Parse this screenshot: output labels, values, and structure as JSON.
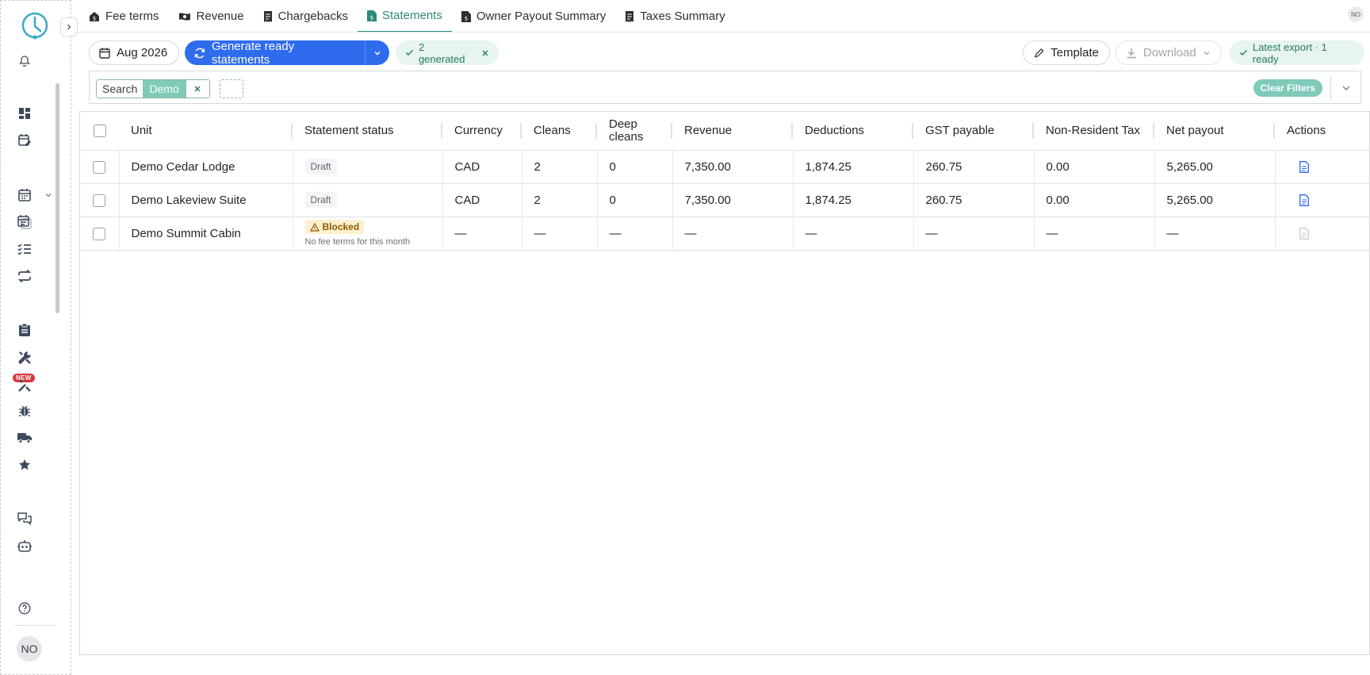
{
  "sidebar": {
    "badge_new": "NEW",
    "avatar_initials": "NO"
  },
  "tabs": [
    {
      "label": "Fee terms",
      "icon": "house-dollar-icon"
    },
    {
      "label": "Revenue",
      "icon": "money-icon"
    },
    {
      "label": "Chargebacks",
      "icon": "receipt-icon"
    },
    {
      "label": "Statements",
      "icon": "file-dollar-icon",
      "active": true
    },
    {
      "label": "Owner Payout Summary",
      "icon": "file-dollar-icon"
    },
    {
      "label": "Taxes Summary",
      "icon": "receipt-icon"
    }
  ],
  "header": {
    "user_initials": "NO"
  },
  "toolbar": {
    "date": "Aug 2026",
    "generate_label": "Generate ready statements",
    "generated_badge": "2 generated",
    "template_label": "Template",
    "download_label": "Download",
    "export_badge": "Latest export · 1 ready"
  },
  "filters": {
    "search_label": "Search",
    "search_value": "Demo",
    "clear_label": "Clear Filters"
  },
  "table": {
    "columns": [
      "Unit",
      "Statement status",
      "Currency",
      "Cleans",
      "Deep\ncleans",
      "Revenue",
      "Deductions",
      "GST payable",
      "Non-Resident Tax",
      "Net payout",
      "Actions"
    ],
    "rows": [
      {
        "unit": "Demo Cedar Lodge",
        "status": "Draft",
        "currency": "CAD",
        "cleans": "2",
        "deep": "0",
        "revenue": "7,350.00",
        "deductions": "1,874.25",
        "gst": "260.75",
        "nrt": "0.00",
        "net": "5,265.00"
      },
      {
        "unit": "Demo Lakeview Suite",
        "status": "Draft",
        "currency": "CAD",
        "cleans": "2",
        "deep": "0",
        "revenue": "7,350.00",
        "deductions": "1,874.25",
        "gst": "260.75",
        "nrt": "0.00",
        "net": "5,265.00"
      },
      {
        "unit": "Demo Summit Cabin",
        "status": "Blocked",
        "status_note": "No fee terms for this month",
        "currency": "—",
        "cleans": "—",
        "deep": "—",
        "revenue": "—",
        "deductions": "—",
        "gst": "—",
        "nrt": "—",
        "net": "—"
      }
    ]
  },
  "colors": {
    "accent": "#2d8a7a",
    "primary": "#2f6bed",
    "badge_bg": "#e7f4ef"
  }
}
